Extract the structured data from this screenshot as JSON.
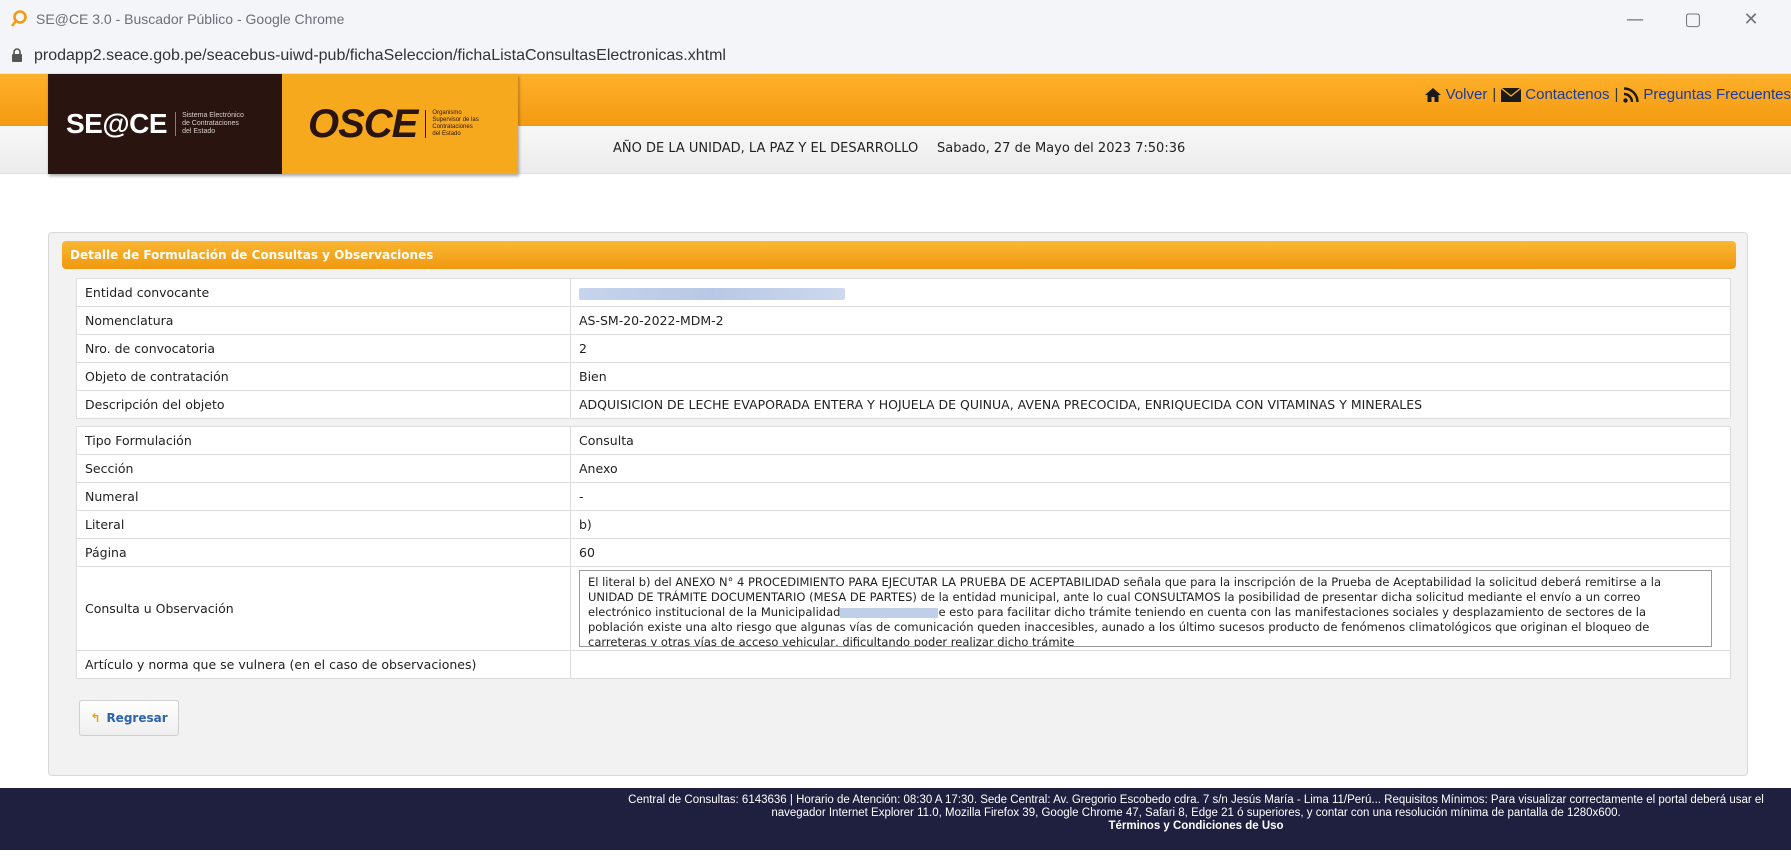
{
  "window": {
    "title": "SE@CE 3.0 - Buscador Público - Google Chrome",
    "minimize": "—",
    "restore": "▢",
    "close": "✕",
    "url": "prodapp2.seace.gob.pe/seacebus-uiwd-pub/fichaSeleccion/fichaListaConsultasElectronicas.xhtml"
  },
  "header": {
    "logo_seace": "SE@CE",
    "logo_seace_sub": [
      "Sistema Electrónico",
      "de Contrataciones",
      "del Estado"
    ],
    "logo_osce": "OSCE",
    "logo_osce_sub": [
      "Organismo",
      "Supervisor de las",
      "Contrataciones",
      "del Estado"
    ],
    "links": {
      "volver": "Volver",
      "contactenos": "Contactenos",
      "preguntas": "Preguntas Frecuentes"
    },
    "motto": "AÑO DE LA UNIDAD, LA PAZ Y EL DESARROLLO",
    "datetime": "Sabado, 27 de Mayo del 2023 7:50:36"
  },
  "panel": {
    "title": "Detalle de Formulación de Consultas y Observaciones",
    "section1": [
      {
        "label": "Entidad convocante",
        "value": ""
      },
      {
        "label": "Nomenclatura",
        "value": "AS-SM-20-2022-MDM-2"
      },
      {
        "label": "Nro. de convocatoria",
        "value": "2"
      },
      {
        "label": "Objeto de contratación",
        "value": "Bien"
      },
      {
        "label": "Descripción del objeto",
        "value": "ADQUISICION DE LECHE EVAPORADA ENTERA Y HOJUELA DE QUINUA, AVENA PRECOCIDA, ENRIQUECIDA CON VITAMINAS Y MINERALES"
      }
    ],
    "section2": [
      {
        "label": "Tipo Formulación",
        "value": "Consulta"
      },
      {
        "label": "Sección",
        "value": "Anexo"
      },
      {
        "label": "Numeral",
        "value": "-"
      },
      {
        "label": "Literal",
        "value": "b)"
      },
      {
        "label": "Página",
        "value": "60"
      }
    ],
    "consulta_label": "Consulta u Observación",
    "consulta_text_a": "El literal b) del ANEXO N° 4 PROCEDIMIENTO PARA EJECUTAR LA PRUEBA DE ACEPTABILIDAD señala que para la inscripción de la Prueba de Aceptabilidad la solicitud deberá remitirse a la UNIDAD DE TRÁMITE DOCUMENTARIO (MESA DE PARTES) de la entidad municipal, ante lo cual CONSULTAMOS la posibilidad de presentar dicha solicitud mediante el envío a un correo electrónico institucional de la Municipalidad",
    "consulta_text_b": "e esto para facilitar dicho trámite teniendo en cuenta con las manifestaciones sociales y desplazamiento de sectores de la población existe una alto riesgo que algunas vías de comunicación queden inaccesibles, aunado a los último sucesos producto de fenómenos climatológicos que originan el bloqueo de carreteras y otras vías de acceso vehicular, dificultando poder realizar dicho trámite",
    "articulo_label": "Artículo y norma que se vulnera (en el caso de observaciones)",
    "articulo_value": "",
    "back_button": "Regresar"
  },
  "footer": {
    "info": "Central de Consultas: 6143636 | Horario de Atención: 08:30 A 17:30. Sede Central: Av. Gregorio Escobedo cdra. 7 s/n Jesús María - Lima 11/Perú... Requisitos Mínimos: Para visualizar correctamente el portal deberá usar el navegador Internet Explorer 11.0, Mozilla Firefox 39, Google Chrome 47, Safari 8, Edge 21 ó superiores, y contar con una resolución mínima de pantalla de 1280x600.",
    "terms": "Términos y Condiciones de Uso"
  },
  "colors": {
    "orange": "#f39a11",
    "dark_brown": "#2a1410",
    "footer_bg": "#1f1f3f",
    "link_blue": "#1a3b9a"
  }
}
